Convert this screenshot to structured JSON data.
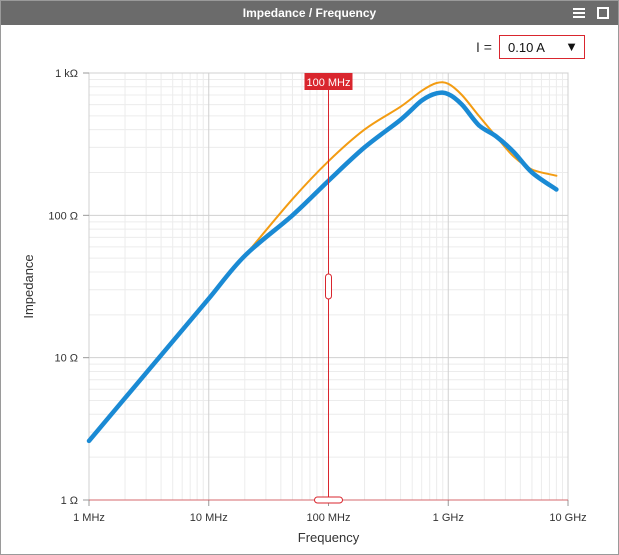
{
  "window": {
    "title": "Impedance / Frequency",
    "menu_icon": "hamburger-icon",
    "maximize_icon": "maximize-icon"
  },
  "controls": {
    "current_label": "I =",
    "current_value": "0.10 A",
    "dropdown_icon": "triangle-down-icon"
  },
  "cursor": {
    "label": "100 MHz",
    "x_value_hz": 100000000,
    "color": "#d9262e"
  },
  "chart_data": {
    "type": "line",
    "xlabel": "Frequency",
    "ylabel": "Impedance",
    "x_scale": "log",
    "y_scale": "log",
    "xlim": [
      1000000,
      10000000000
    ],
    "ylim": [
      1,
      1000
    ],
    "x_ticks": [
      {
        "value": 1000000,
        "label": "1 MHz"
      },
      {
        "value": 10000000,
        "label": "10 MHz"
      },
      {
        "value": 100000000,
        "label": "100 MHz"
      },
      {
        "value": 1000000000,
        "label": "1 GHz"
      },
      {
        "value": 10000000000,
        "label": "10 GHz"
      }
    ],
    "y_ticks": [
      {
        "value": 1,
        "label": "1 Ω"
      },
      {
        "value": 10,
        "label": "10 Ω"
      },
      {
        "value": 100,
        "label": "100 Ω"
      },
      {
        "value": 1000,
        "label": "1 kΩ"
      }
    ],
    "grid": true,
    "series": [
      {
        "color": "#f39c12",
        "x": [
          1000000,
          2000000,
          5000000,
          10000000,
          20000000,
          50000000,
          100000000,
          200000000,
          400000000,
          600000000,
          800000000,
          1000000000,
          1300000000,
          1800000000,
          2500000000,
          3500000000,
          5000000000,
          8000000000
        ],
        "y": [
          2.6,
          5.2,
          13,
          26,
          52,
          130,
          240,
          400,
          580,
          750,
          850,
          840,
          700,
          500,
          360,
          260,
          210,
          190
        ]
      },
      {
        "color": "#1a8ad4",
        "x": [
          1000000,
          2000000,
          5000000,
          10000000,
          20000000,
          50000000,
          100000000,
          200000000,
          400000000,
          600000000,
          800000000,
          1000000000,
          1300000000,
          1800000000,
          2500000000,
          3500000000,
          5000000000,
          8000000000
        ],
        "y": [
          2.6,
          5.2,
          13,
          26,
          52,
          100,
          175,
          300,
          470,
          640,
          720,
          710,
          600,
          430,
          360,
          280,
          200,
          152
        ]
      }
    ]
  }
}
